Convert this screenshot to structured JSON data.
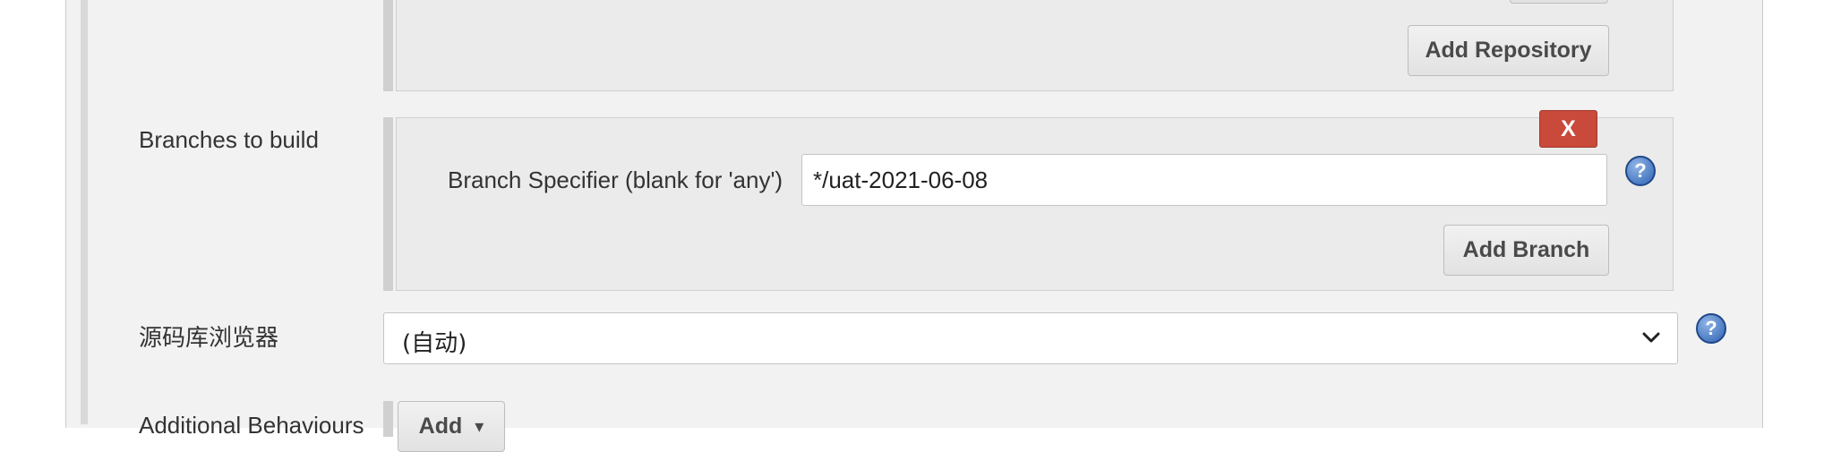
{
  "repositories": {
    "add_repository_label": "Add Repository"
  },
  "branches": {
    "label": "Branches to build",
    "delete_label": "X",
    "specifier_label": "Branch Specifier (blank for 'any')",
    "specifier_value": "*/uat-2021-06-08",
    "add_branch_label": "Add Branch",
    "help_glyph": "?"
  },
  "repo_browser": {
    "label": "源码库浏览器",
    "selected_value": "(自动)",
    "help_glyph": "?"
  },
  "additional_behaviours": {
    "label": "Additional Behaviours",
    "add_label": "Add",
    "caret": "▾"
  },
  "icons": {
    "help": "help-icon",
    "chevron": "chevron-down-icon"
  },
  "colors": {
    "delete_button": "#c9493a",
    "help_icon": "#2f63b4",
    "panel_background": "#f2f2f2"
  }
}
